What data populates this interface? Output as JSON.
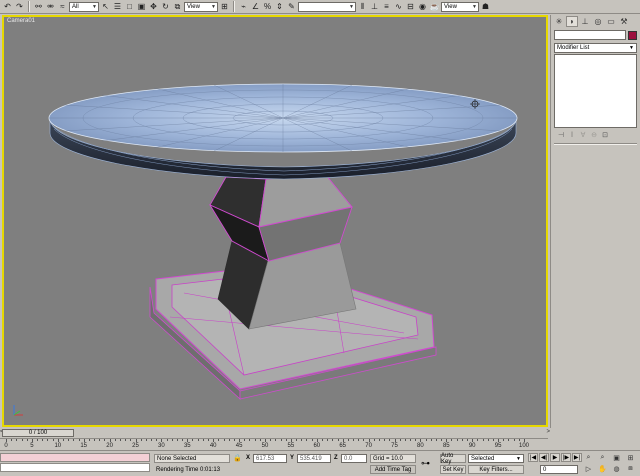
{
  "toolbar": {
    "selection_filter": "All",
    "ref_coord": "View",
    "named_selection": "",
    "render_view": "View",
    "buttons": [
      "undo-icon",
      "redo-icon",
      "link-icon",
      "unlink-icon",
      "bind-warp-icon",
      "select-object-icon",
      "select-by-name-icon",
      "region-select-icon",
      "window-crossing-icon",
      "move-icon",
      "rotate-icon",
      "scale-icon",
      "pivot-icon",
      "snap-icon",
      "angle-snap-icon",
      "percent-snap-icon",
      "spinner-snap-icon",
      "mirror-icon",
      "align-icon",
      "layer-icon",
      "curve-editor-icon",
      "schematic-icon",
      "material-editor-icon",
      "render-scene-icon",
      "quick-render-icon"
    ]
  },
  "viewport": {
    "label": "Camera01"
  },
  "command_panel": {
    "tabs": [
      "create-tab",
      "modify-tab",
      "hierarchy-tab",
      "motion-tab",
      "display-tab",
      "utilities-tab"
    ],
    "active_tab": 1,
    "name_value": "",
    "object_color": "#9c0f3e",
    "modifier_list_label": "Modifier List"
  },
  "time_slider": {
    "position_label": "0 / 100",
    "left_arrow": "<",
    "right_arrow": ">"
  },
  "timeline": {
    "ticks": [
      "0",
      "5",
      "10",
      "15",
      "20",
      "25",
      "30",
      "35",
      "40",
      "45",
      "50",
      "55",
      "60",
      "65",
      "70",
      "75",
      "80",
      "85",
      "90",
      "95",
      "100"
    ]
  },
  "status": {
    "selection": "None Selected",
    "rendering_time": "Rendering Time  0:01:13",
    "x_label": "X",
    "x_value": "617.53",
    "y_label": "Y",
    "y_value": "535.419",
    "z_label": "Z",
    "z_value": "0.0",
    "grid": "Grid = 10.0",
    "add_time_tag": "Add Time Tag",
    "auto_key": "Auto Key",
    "set_key": "Set Key",
    "key_mode": "Selected",
    "key_filters": "Key Filters...",
    "current_frame": "0"
  }
}
